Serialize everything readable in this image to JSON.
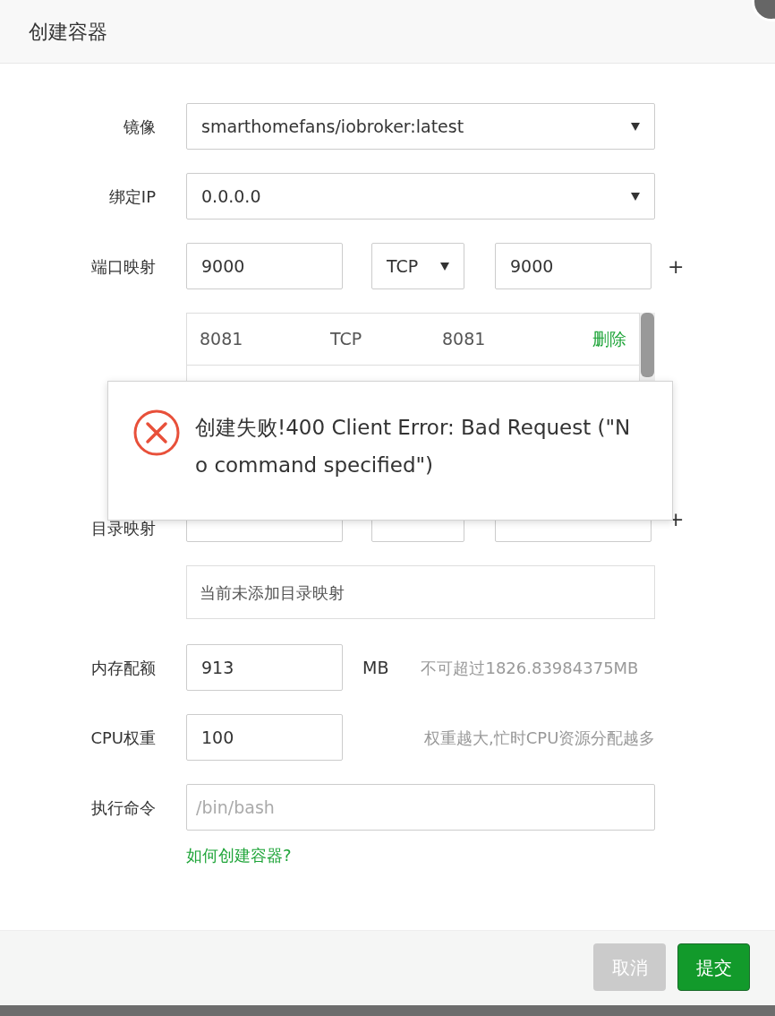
{
  "dialog": {
    "title": "创建容器"
  },
  "fields": [
    {
      "kind": "select",
      "label": "镜像",
      "value": "smarthomefans/iobroker:latest"
    },
    {
      "kind": "select",
      "label": "绑定IP",
      "value": "0.0.0.0"
    }
  ],
  "port_mapping": {
    "label": "端口映射",
    "host_port": "9000",
    "protocol": "TCP",
    "container_port": "9000",
    "add": "+",
    "rows": [
      {
        "host_port": "8081",
        "protocol": "TCP",
        "container_port": "8081",
        "action": "删除"
      }
    ]
  },
  "dir_mapping": {
    "label": "目录映射",
    "add": "+",
    "empty_text": "当前未添加目录映射"
  },
  "memory": {
    "label": "内存配额",
    "value": "913",
    "unit": "MB",
    "hint": "不可超过1826.83984375MB"
  },
  "cpu": {
    "label": "CPU权重",
    "value": "100",
    "hint": "权重越大,忙时CPU资源分配越多"
  },
  "command": {
    "label": "执行命令",
    "placeholder": "/bin/bash"
  },
  "help_link": "如何创建容器?",
  "buttons": [
    {
      "label": "取消",
      "kind": "secondary"
    },
    {
      "label": "提交",
      "kind": "primary"
    }
  ],
  "toast": {
    "kind": "error",
    "message": "创建失败!400 Client Error: Bad Request (\"No command specified\")"
  }
}
